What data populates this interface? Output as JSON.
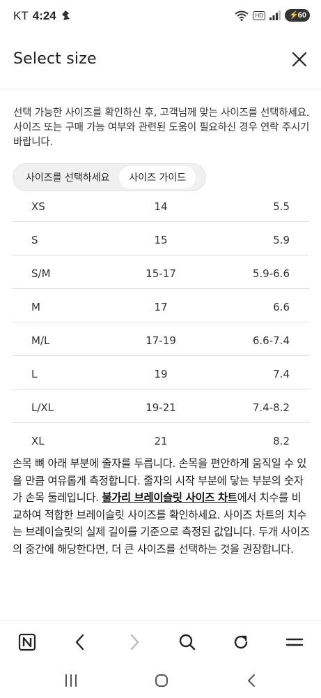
{
  "status_bar": {
    "carrier": "KT",
    "time": "4:24",
    "hd_label": "HD",
    "battery": "60"
  },
  "header": {
    "title": "Select size"
  },
  "intro_text": "선택 가능한 사이즈를 확인하신 후, 고객님께 맞는 사이즈를 선택하세요. 사이즈 또는 구매 가능 여부와 관련된 도움이 필요하신 경우 연락 주시기 바랍니다.",
  "tabs": [
    {
      "label": "사이즈를 선택하세요",
      "active": false
    },
    {
      "label": "사이즈 가이드",
      "active": true
    }
  ],
  "size_table": {
    "rows": [
      [
        "XS",
        "14",
        "5.5"
      ],
      [
        "S",
        "15",
        "5.9"
      ],
      [
        "S/M",
        "15-17",
        "5.9-6.6"
      ],
      [
        "M",
        "17",
        "6.6"
      ],
      [
        "M/L",
        "17-19",
        "6.6-7.4"
      ],
      [
        "L",
        "19",
        "7.4"
      ],
      [
        "L/XL",
        "19-21",
        "7.4-8.2"
      ],
      [
        "XL",
        "21",
        "8.2"
      ]
    ]
  },
  "guide": {
    "before_link": "손목 뼈 아래 부분에 줄자를 두릅니다. 손목을 편안하게 움직일 수 있을 만큼 여유롭게 측정합니다. 줄자의 시작 부분에 닿는 부분의 숫자가 손목 둘레입니다. ",
    "link": "불가리 브레이슬릿 사이즈 차트",
    "after_link": "에서 치수를 비교하여 적합한 브레이슬릿 사이즈를 확인하세요. 사이즈 차트의 치수는 브레이슬릿의 실제 길이를 기준으로 측정된 값입니다. 두개 사이즈의 중간에 해당한다면, 더 큰 사이즈를 선택하는 것을 권장합니다."
  },
  "icons": {
    "close": "close-icon",
    "browser_home": "naver-n-icon",
    "back": "chevron-left-icon",
    "forward": "chevron-right-icon",
    "search": "search-icon",
    "refresh": "refresh-icon",
    "menu": "hamburger-menu-icon"
  }
}
